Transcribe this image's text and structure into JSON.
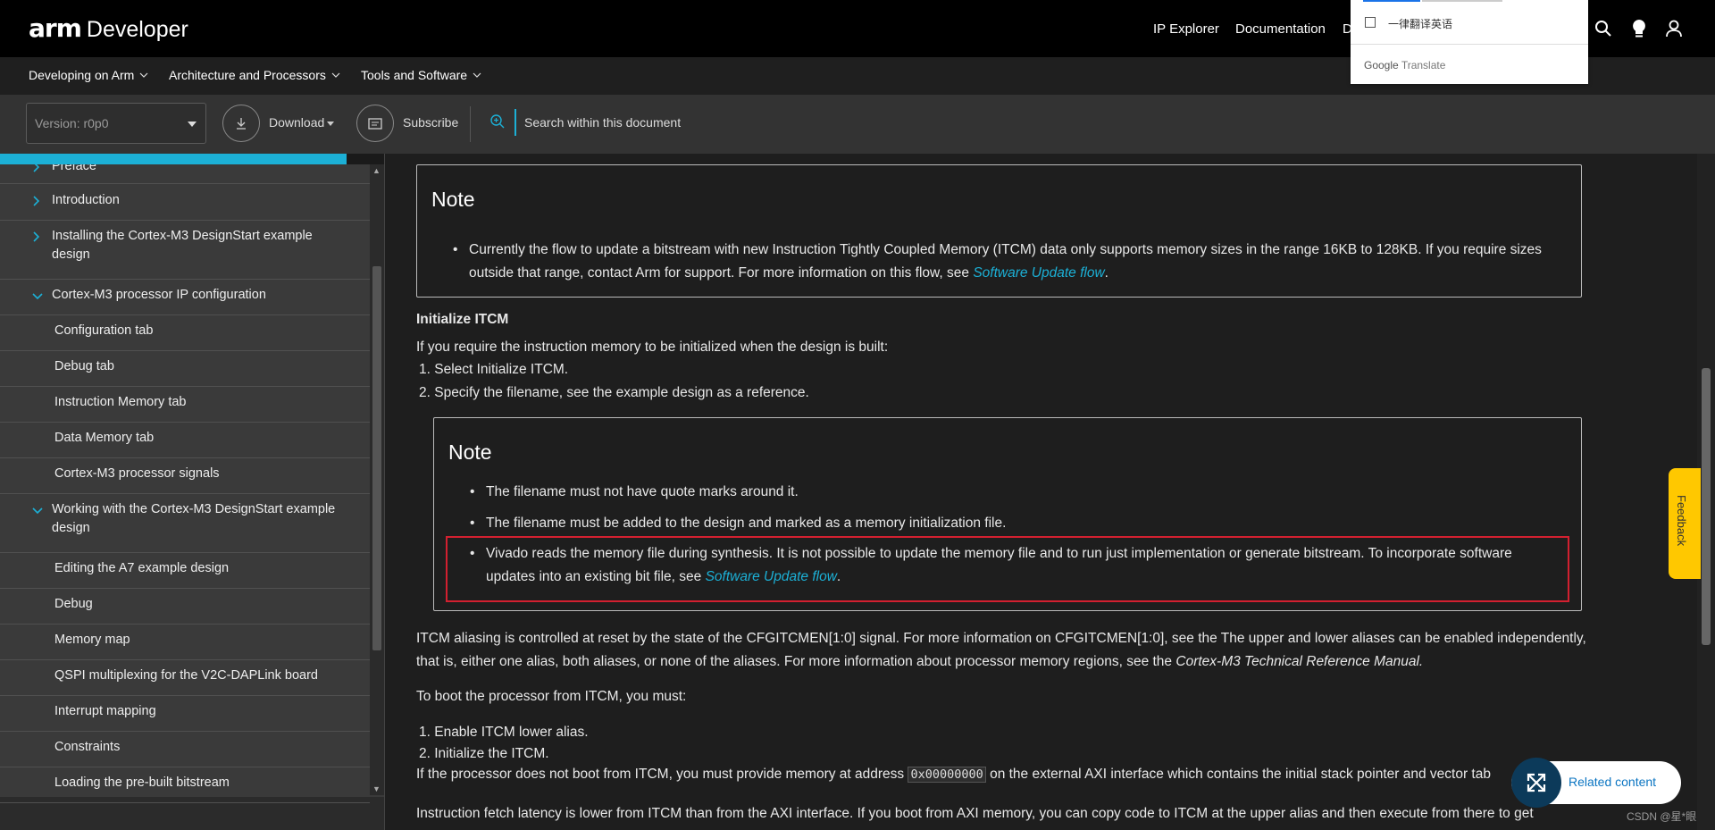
{
  "brand": {
    "arm": "arm",
    "developer": "Developer"
  },
  "topnav": {
    "ip_explorer": "IP Explorer",
    "documentation": "Documentation",
    "cut": "D"
  },
  "subnav": {
    "items": [
      "Developing on Arm",
      "Architecture and Processors",
      "Tools and Software"
    ]
  },
  "toolbar": {
    "version": "Version: r0p0",
    "download": "Download",
    "subscribe": "Subscribe",
    "search": "Search within this document"
  },
  "translate": {
    "checkbox_label": "一律翻译英语",
    "google": "Google",
    "translate": "Translate"
  },
  "toc": {
    "items": [
      {
        "label": "Preface",
        "chevron": "right"
      },
      {
        "label": "Introduction",
        "chevron": "right"
      },
      {
        "label": "Installing the Cortex-M3 DesignStart example design",
        "chevron": "right"
      },
      {
        "label": "Cortex-M3 processor IP configuration",
        "chevron": "down"
      },
      {
        "label": "Configuration tab",
        "chevron": ""
      },
      {
        "label": "Debug tab",
        "chevron": ""
      },
      {
        "label": "Instruction Memory tab",
        "chevron": ""
      },
      {
        "label": "Data Memory tab",
        "chevron": ""
      },
      {
        "label": "Cortex-M3 processor signals",
        "chevron": ""
      },
      {
        "label": "Working with the Cortex-M3 DesignStart example design",
        "chevron": "down"
      },
      {
        "label": "Editing the A7 example design",
        "chevron": ""
      },
      {
        "label": "Debug",
        "chevron": ""
      },
      {
        "label": "Memory map",
        "chevron": ""
      },
      {
        "label": "QSPI multiplexing for the V2C-DAPLink board",
        "chevron": ""
      },
      {
        "label": "Interrupt mapping",
        "chevron": ""
      },
      {
        "label": "Constraints",
        "chevron": ""
      },
      {
        "label": "Loading the pre-built bitstream",
        "chevron": ""
      }
    ]
  },
  "content": {
    "note1": {
      "title": "Note",
      "text_a": "Currently the flow to update a bitstream with new Instruction Tightly Coupled Memory (ITCM) data only supports memory sizes in the range 16KB to 128KB. If you require sizes",
      "text_b": "outside that range, contact Arm for support. For more information on this flow, see",
      "link": "Software Update flow",
      "end": "."
    },
    "heading": "Initialize ITCM",
    "intro": "If you require the instruction memory to be initialized when the design is built:",
    "steps": [
      "1. Select Initialize ITCM.",
      "2. Specify the filename, see the example design as a reference."
    ],
    "note2": {
      "title": "Note",
      "b1": "The filename must not have quote marks around it.",
      "b2": "The filename must be added to the design and marked as a memory initialization file.",
      "b3a": "Vivado reads the memory file during synthesis. It is not possible to update the memory file and to run just implementation or generate bitstream. To incorporate software",
      "b3b": "updates into an existing bit file, see",
      "link": "Software Update flow",
      "end": "."
    },
    "alias_a": "ITCM aliasing is controlled at reset by the state of the CFGITCMEN[1:0] signal. For more information on CFGITCMEN[1:0], see the The upper and lower aliases can be enabled",
    "alias_b": "independently, that is, either one alias, both aliases, or none of the aliases. For more information about processor memory regions, see the",
    "alias_ref": "Cortex-M3 Technical Reference Manual.",
    "boot_intro": "To boot the processor from ITCM, you must:",
    "boot_steps": [
      "1. Enable ITCM lower alias.",
      "2. Initialize the ITCM."
    ],
    "noboot_a": "If the processor does not boot from ITCM, you must provide memory at address",
    "noboot_code": "0x00000000",
    "noboot_b": "on the external AXI interface which contains the initial stack pointer and vector tab",
    "latency": "Instruction fetch latency is lower from ITCM than from the AXI interface. If you boot from AXI memory, you can copy code to ITCM at the upper alias and then execute from there to get"
  },
  "feedback": "Feedback",
  "related": "Related content",
  "footer": "CSDN @星*眼"
}
